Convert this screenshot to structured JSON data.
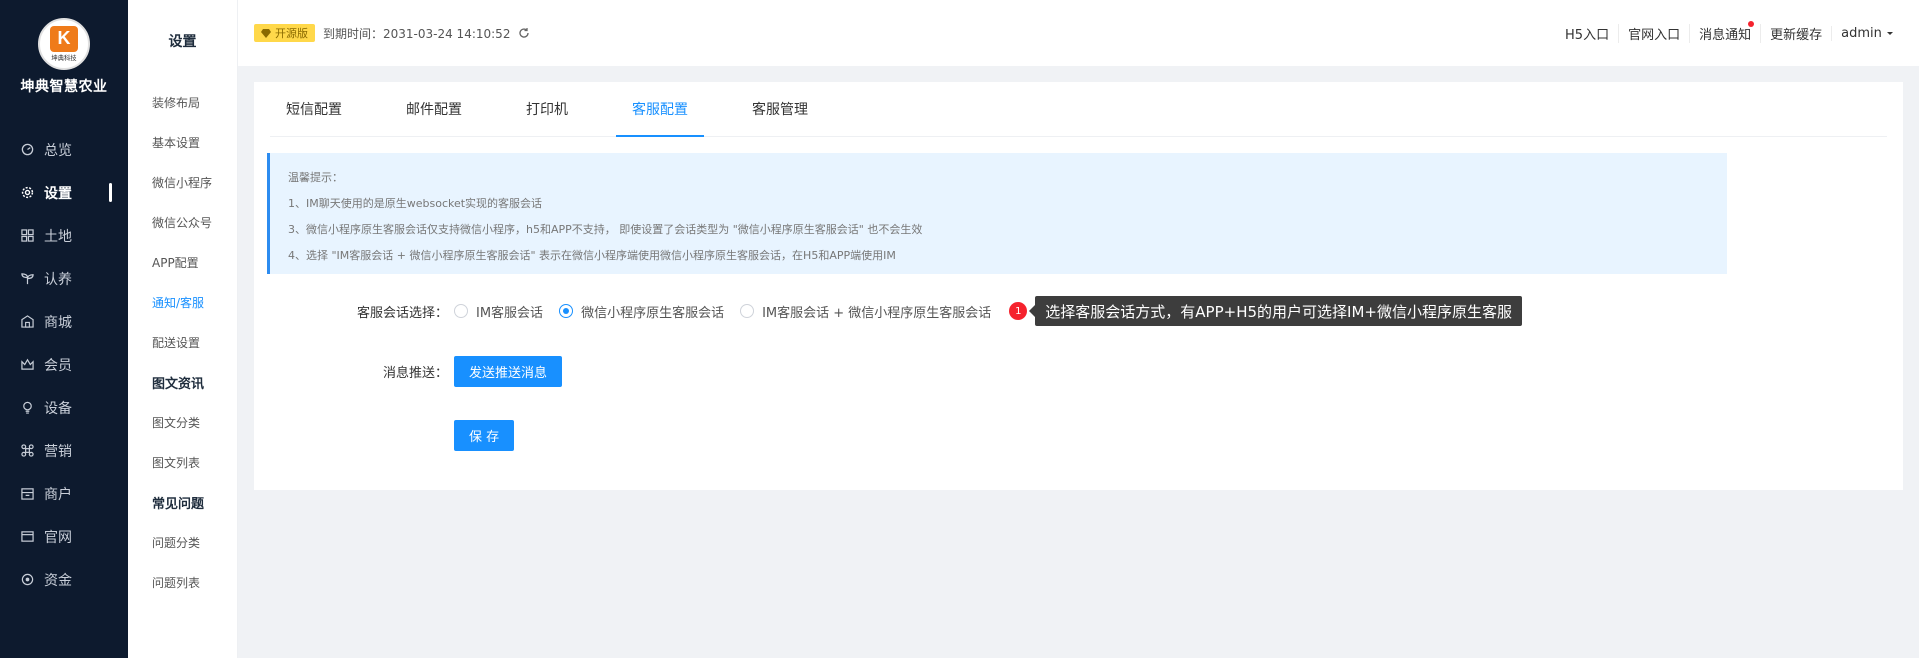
{
  "brand": {
    "logo_letter": "K",
    "logo_sub": "坤典科技",
    "name": "坤典智慧农业"
  },
  "nav": {
    "items": [
      {
        "label": "总览",
        "icon": "dashboard-icon"
      },
      {
        "label": "设置",
        "icon": "gear-icon",
        "active": true
      },
      {
        "label": "土地",
        "icon": "grid-icon"
      },
      {
        "label": "认养",
        "icon": "sprout-icon"
      },
      {
        "label": "商城",
        "icon": "store-icon"
      },
      {
        "label": "会员",
        "icon": "crown-icon"
      },
      {
        "label": "设备",
        "icon": "bulb-icon"
      },
      {
        "label": "营销",
        "icon": "command-icon"
      },
      {
        "label": "商户",
        "icon": "shop-icon"
      },
      {
        "label": "官网",
        "icon": "window-icon"
      },
      {
        "label": "资金",
        "icon": "coin-icon"
      }
    ]
  },
  "subnav": {
    "title": "设置",
    "items": [
      {
        "label": "装修布局",
        "type": "item"
      },
      {
        "label": "基本设置",
        "type": "item"
      },
      {
        "label": "微信小程序",
        "type": "item"
      },
      {
        "label": "微信公众号",
        "type": "item"
      },
      {
        "label": "APP配置",
        "type": "item"
      },
      {
        "label": "通知/客服",
        "type": "item",
        "active": true
      },
      {
        "label": "配送设置",
        "type": "item"
      },
      {
        "label": "图文资讯",
        "type": "group"
      },
      {
        "label": "图文分类",
        "type": "item"
      },
      {
        "label": "图文列表",
        "type": "item"
      },
      {
        "label": "常见问题",
        "type": "group"
      },
      {
        "label": "问题分类",
        "type": "item"
      },
      {
        "label": "问题列表",
        "type": "item"
      }
    ]
  },
  "header": {
    "badge": "开源版",
    "expire": "到期时间：2031-03-24 14:10:52",
    "links": [
      "H5入口",
      "官网入口",
      "消息通知",
      "更新缓存"
    ],
    "user": "admin"
  },
  "tabs": [
    {
      "label": "短信配置"
    },
    {
      "label": "邮件配置"
    },
    {
      "label": "打印机"
    },
    {
      "label": "客服配置",
      "active": true
    },
    {
      "label": "客服管理"
    }
  ],
  "tips": {
    "title": "温馨提示：",
    "lines": [
      "1、IM聊天使用的是原生websocket实现的客服会话",
      "3、微信小程序原生客服会话仅支持微信小程序，h5和APP不支持， 即使设置了会话类型为 \"微信小程序原生客服会话\" 也不会生效",
      "4、选择 \"IM客服会话 + 微信小程序原生客服会话\" 表示在微信小程序端使用微信小程序原生客服会话，在H5和APP端使用IM"
    ]
  },
  "form": {
    "session_label": "客服会话选择：",
    "options": [
      {
        "label": "IM客服会话",
        "checked": false
      },
      {
        "label": "微信小程序原生客服会话",
        "checked": true
      },
      {
        "label": "IM客服会话 + 微信小程序原生客服会话",
        "checked": false
      }
    ],
    "hint_number": "1",
    "hint_text": "选择客服会话方式，有APP+H5的用户可选择IM+微信小程序原生客服",
    "push_label": "消息推送：",
    "push_button": "发送推送消息",
    "save_button": "保 存"
  },
  "colors": {
    "primary": "#1890ff",
    "sidebar": "#0d1a2e",
    "badge": "#ffd84a"
  }
}
